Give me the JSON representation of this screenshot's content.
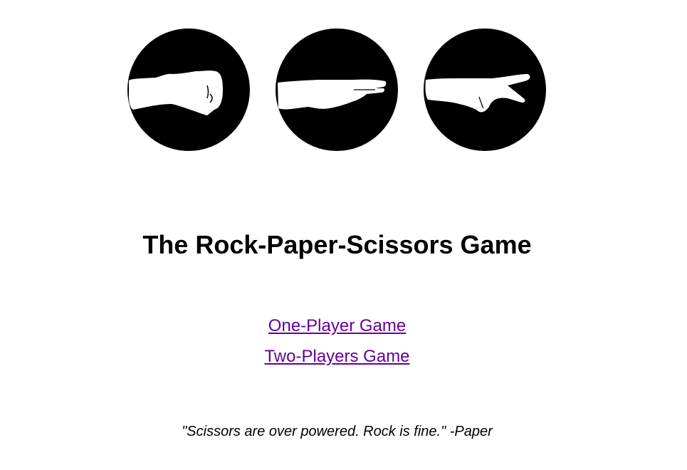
{
  "icons": {
    "rock": "rock-hand-icon",
    "paper": "paper-hand-icon",
    "scissors": "scissors-hand-icon"
  },
  "title": "The Rock-Paper-Scissors Game",
  "menu": {
    "one_player": "One-Player Game",
    "two_players": "Two-Players Game"
  },
  "quote": "\"Scissors are over powered. Rock is fine.\" -Paper",
  "colors": {
    "link": "#660099",
    "icon_background": "#000000",
    "hand": "#ffffff"
  }
}
